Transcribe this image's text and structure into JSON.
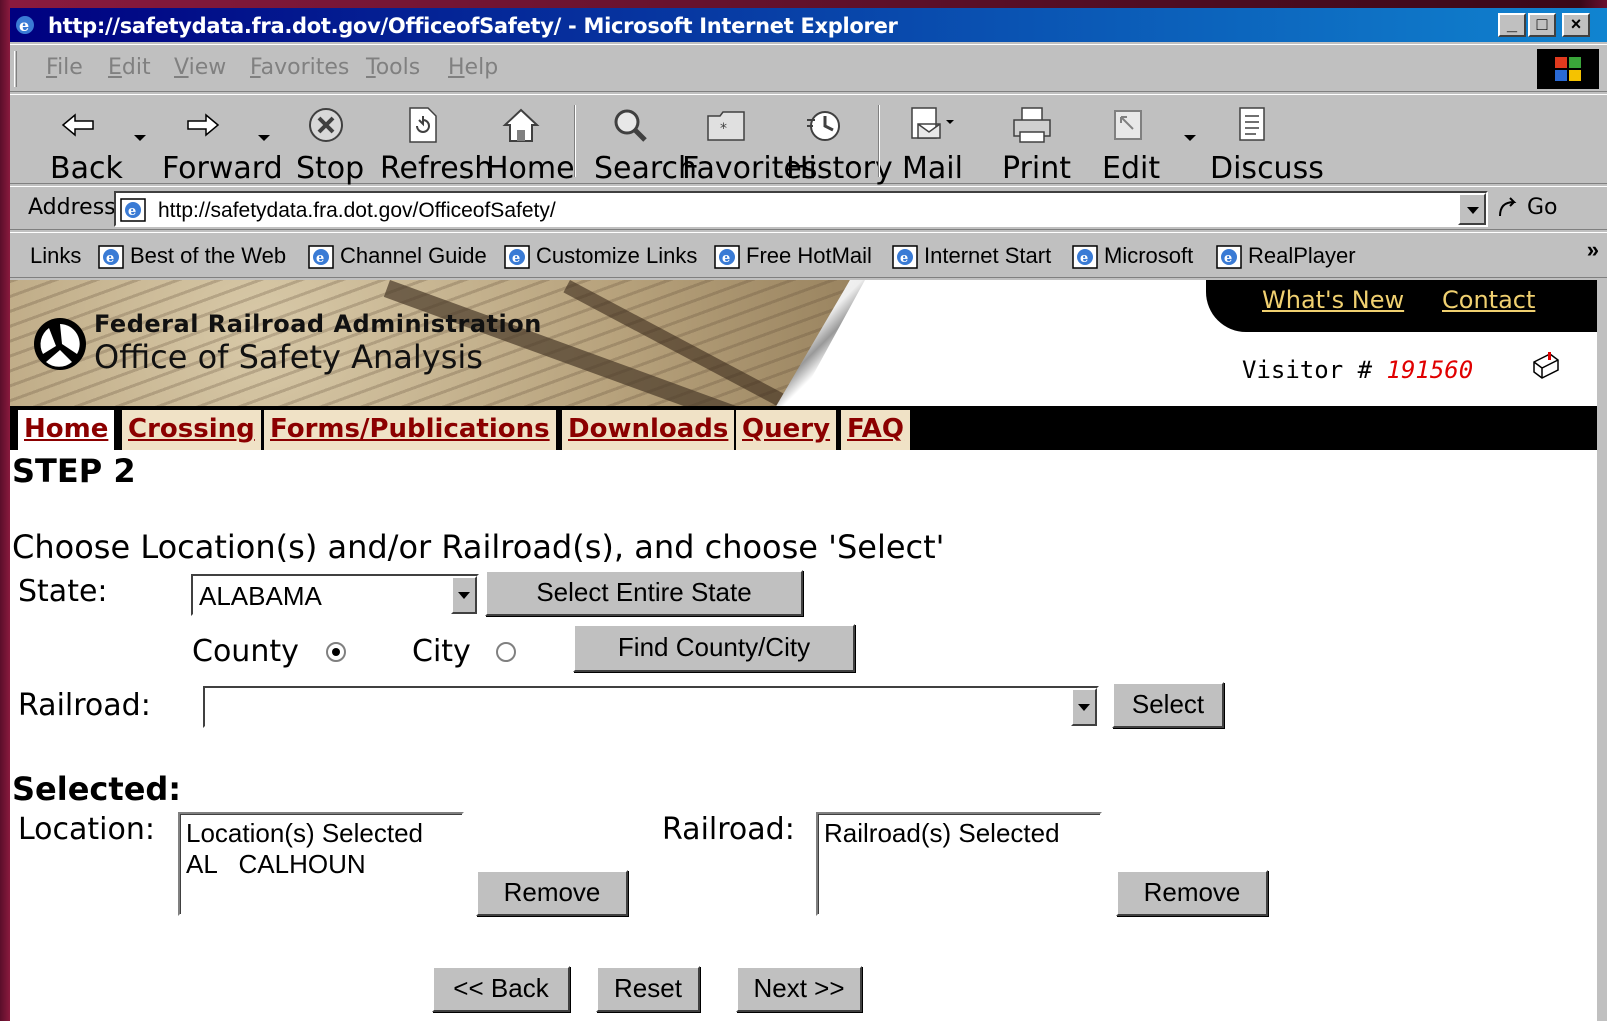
{
  "window": {
    "title": "http://safetydata.fra.dot.gov/OfficeofSafety/ - Microsoft Internet Explorer",
    "controls": {
      "minimize": "_",
      "maximize": "□",
      "close": "×"
    }
  },
  "menu": [
    "File",
    "Edit",
    "View",
    "Favorites",
    "Tools",
    "Help"
  ],
  "toolbar": {
    "back": "Back",
    "forward": "Forward",
    "stop": "Stop",
    "refresh": "Refresh",
    "home": "Home",
    "search": "Search",
    "favorites": "Favorites",
    "history": "History",
    "mail": "Mail",
    "print": "Print",
    "edit": "Edit",
    "discuss": "Discuss"
  },
  "address": {
    "label": "Address",
    "url": "http://safetydata.fra.dot.gov/OfficeofSafety/",
    "go": "Go"
  },
  "links": {
    "label": "Links",
    "items": [
      "Best of the Web",
      "Channel Guide",
      "Customize Links",
      "Free HotMail",
      "Internet Start",
      "Microsoft",
      "RealPlayer"
    ],
    "more": "»"
  },
  "site": {
    "org": "Federal Railroad Administration",
    "office": "Office of Safety Analysis",
    "whats_new": "What's New",
    "contact": "Contact",
    "visitor_label": "Visitor #",
    "visitor_number": "191560",
    "nav": [
      "Home",
      "Crossing",
      "Forms/Publications",
      "Downloads",
      "Query",
      "FAQ"
    ]
  },
  "form": {
    "step": "STEP 2",
    "instruction": "Choose Location(s) and/or Railroad(s), and choose 'Select'",
    "state_label": "State:",
    "state_value": "ALABAMA",
    "select_state_btn": "Select Entire State",
    "county_label": "County",
    "city_label": "City",
    "county_checked": true,
    "find_btn": "Find County/City",
    "railroad_label": "Railroad:",
    "railroad_value": "",
    "select_btn": "Select",
    "selected_heading": "Selected:",
    "location_label": "Location:",
    "location_list": [
      "Location(s) Selected",
      "AL   CALHOUN"
    ],
    "railroad_sel_label": "Railroad:",
    "railroad_list": [
      "Railroad(s) Selected"
    ],
    "remove_btn": "Remove",
    "back_btn": "<< Back",
    "reset_btn": "Reset",
    "next_btn": "Next >>"
  }
}
